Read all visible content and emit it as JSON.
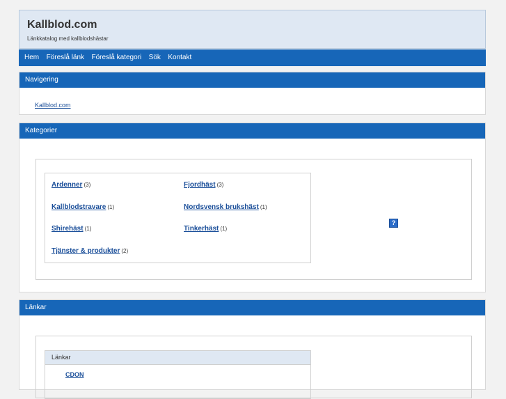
{
  "header": {
    "title": "Kallblod.com",
    "slogan": "Länkkatalog med kallblodshästar"
  },
  "nav": {
    "items": [
      "Hem",
      "Föreslå länk",
      "Föreslå kategori",
      "Sök",
      "Kontakt"
    ]
  },
  "navigation_panel": {
    "title": "Navigering",
    "link": "Kallblod.com"
  },
  "categories_panel": {
    "title": "Kategorier",
    "items": [
      {
        "label": "Ardenner",
        "count": "(3)"
      },
      {
        "label": "Fjordhäst",
        "count": "(3)"
      },
      {
        "label": "Kallblodstravare",
        "count": "(1)"
      },
      {
        "label": "Nordsvensk brukshäst",
        "count": "(1)"
      },
      {
        "label": "Shirehäst",
        "count": "(1)"
      },
      {
        "label": "Tinkerhäst",
        "count": "(1)"
      },
      {
        "label": "Tjänster & produkter",
        "count": "(2)"
      }
    ],
    "help_icon": "?"
  },
  "links_panel": {
    "title": "Länkar",
    "box_title": "Länkar",
    "items": [
      "CDON"
    ]
  }
}
